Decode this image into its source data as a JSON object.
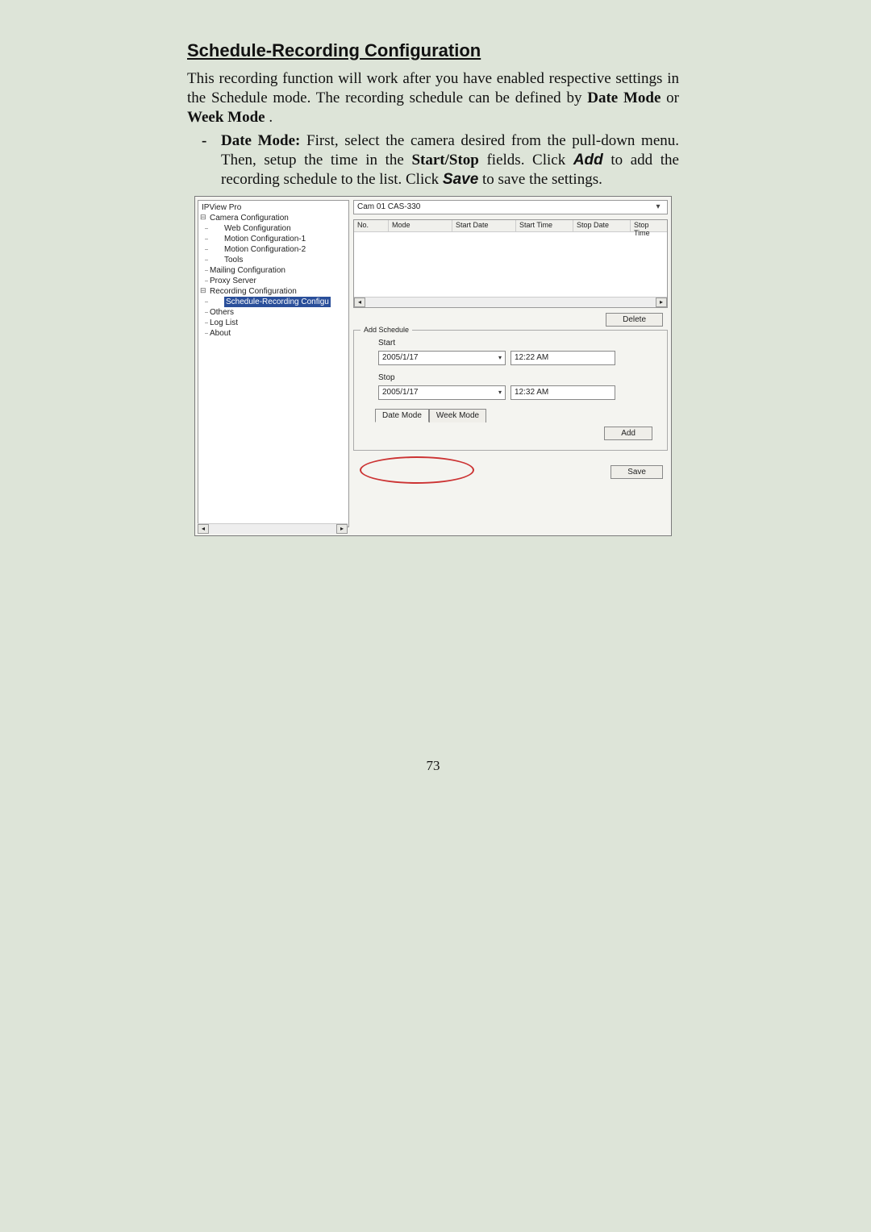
{
  "heading": "Schedule-Recording Configuration",
  "intro": "This recording function will work after you have enabled respective settings in the Schedule mode.  The recording schedule can be defined by ",
  "intro_bold1": "Date Mode",
  "intro_or": " or ",
  "intro_bold2": "Week Mode",
  "intro_end": ".",
  "bullet": {
    "title": "Date Mode:",
    "t1": " First, select the camera desired from the pull-down menu.  Then, setup the time in the ",
    "bold_startstop": "Start/Stop",
    "t2": " fields.  Click ",
    "btn_add": "Add",
    "t3": " to add the recording schedule to the list.  Click ",
    "btn_save": "Save",
    "t4": " to save the settings."
  },
  "panel": {
    "tree": {
      "root": "IPView Pro",
      "camconf": "Camera Configuration",
      "web": "Web Configuration",
      "motion1": "Motion Configuration-1",
      "motion2": "Motion Configuration-2",
      "tools": "Tools",
      "mailing": "Mailing Configuration",
      "proxy": "Proxy Server",
      "recconf": "Recording Configuration",
      "sched": "Schedule-Recording Configu",
      "others": "Others",
      "loglist": "Log List",
      "about": "About"
    },
    "camera": "Cam 01    CAS-330",
    "columns": {
      "no": "No.",
      "mode": "Mode",
      "startdate": "Start Date",
      "starttime": "Start Time",
      "stopdate": "Stop Date",
      "stoptime": "Stop Time"
    },
    "delete": "Delete",
    "addschedule": "Add Schedule",
    "start_label": "Start",
    "stop_label": "Stop",
    "start_date": "2005/1/17",
    "start_time": "12:22 AM",
    "stop_date": "2005/1/17",
    "stop_time": "12:32 AM",
    "tab_date": "Date Mode",
    "tab_week": "Week Mode",
    "add": "Add",
    "save": "Save"
  },
  "pagenum": "73"
}
